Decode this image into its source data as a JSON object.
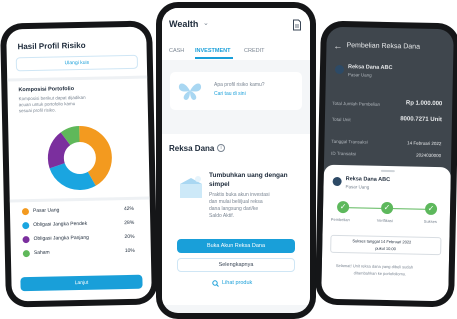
{
  "phone1": {
    "title": "Hasil Profil Risiko",
    "retake_btn": "Ulangi kuis",
    "portfolio_title": "Komposisi Portofolio",
    "portfolio_desc_1": "Komposisi berikut dapat dijadikan",
    "portfolio_desc_2": "acuan untuk portofolio kamu",
    "portfolio_desc_3": "sesuai profil risiko.",
    "legend": [
      {
        "name": "Pasar Uang",
        "pct": "42%",
        "color": "#f39a1f"
      },
      {
        "name": "Obligasi Jangka Pendek",
        "pct": "28%",
        "color": "#1aa5e0"
      },
      {
        "name": "Obligasi Jangka Panjang",
        "pct": "20%",
        "color": "#7b2f9e"
      },
      {
        "name": "Saham",
        "pct": "10%",
        "color": "#5fb85a"
      }
    ],
    "cta_btn": "Lanjut"
  },
  "phone2": {
    "app_title": "Wealth",
    "tabs": [
      "CASH",
      "INVESTMENT",
      "CREDIT"
    ],
    "banner_q": "Apa profil risiko kamu?",
    "banner_link": "Cari tau di sini",
    "section_title": "Reksa Dana",
    "info_icon": "i",
    "card_title_1": "Tumbuhkan uang dengan",
    "card_title_2": "simpel",
    "card_desc_1": "Praktis buka akun investasi",
    "card_desc_2": "dan mulai beli/jual reksa",
    "card_desc_3": "dana langsung dari/ke",
    "card_desc_4": "Saldo Aktif.",
    "open_btn": "Buka Akun Reksa Dana",
    "more_btn": "Selengkapnya",
    "view_link": "Lihat produk"
  },
  "phone3": {
    "header": "Pembelian Reksa Dana",
    "fund_name": "Reksa Dana ABC",
    "fund_type": "Pasar Uang",
    "rows": [
      {
        "label": "Total Jumlah Pembelian",
        "value": "Rp 1.000.000"
      },
      {
        "label": "Total Unit",
        "value": "8000.7271 Unit"
      },
      {
        "label": "Tanggal Transaksi",
        "value": "14 Februari 2022"
      },
      {
        "label": "ID Transaksi",
        "value": "2024030000"
      }
    ],
    "sheet_fund": "Reksa Dana ABC",
    "sheet_type": "Pasar Uang",
    "steps": [
      "Pembelian",
      "Verifikasi",
      "Sukses"
    ],
    "success_1": "Sukses tanggal 14 Februari 2022",
    "success_2": "pukul 10.00",
    "footer_1": "Selamat! Unit reksa dana yang dibeli sudah",
    "footer_2": "ditambahkan ke portofoliomu."
  }
}
